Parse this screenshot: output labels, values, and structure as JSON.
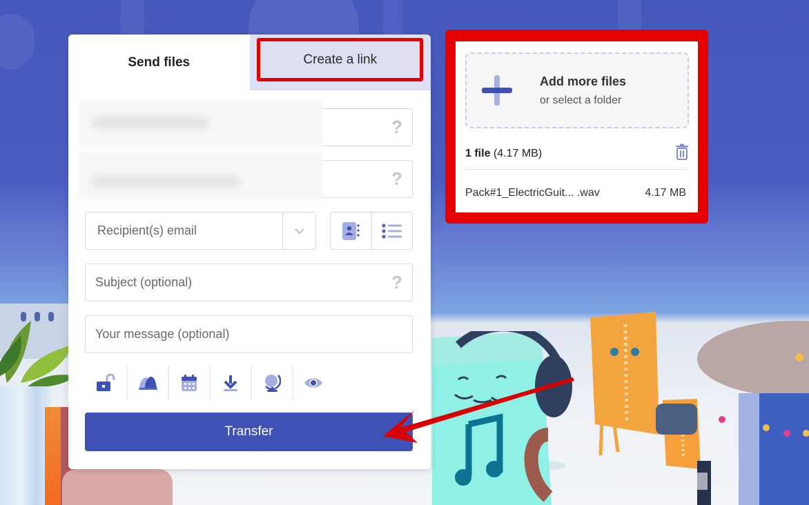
{
  "tabs": {
    "send_files": "Send files",
    "create_link": "Create a link",
    "active": "send_files"
  },
  "form": {
    "field1_help": "?",
    "field2_help": "?",
    "recipient_placeholder": "Recipient(s) email",
    "subject_placeholder": "Subject (optional)",
    "subject_help": "?",
    "message_placeholder": "Your message (optional)",
    "option_icons": [
      "unlock-icon",
      "bell-icon",
      "calendar-icon",
      "download-icon",
      "globe-icon",
      "eye-icon"
    ],
    "transfer_label": "Transfer"
  },
  "files_panel": {
    "add_title": "Add more files",
    "add_subtitle": "or select a folder",
    "count_label": "1 file",
    "total_size": "(4.17 MB)",
    "files": [
      {
        "name": "Pack#1_ElectricGuit... .wav",
        "size": "4.17 MB"
      }
    ]
  },
  "colors": {
    "accent": "#3f51b5",
    "highlight": "#e60000",
    "tab_inactive": "#dde0f2",
    "background_top": "#4758bd"
  }
}
